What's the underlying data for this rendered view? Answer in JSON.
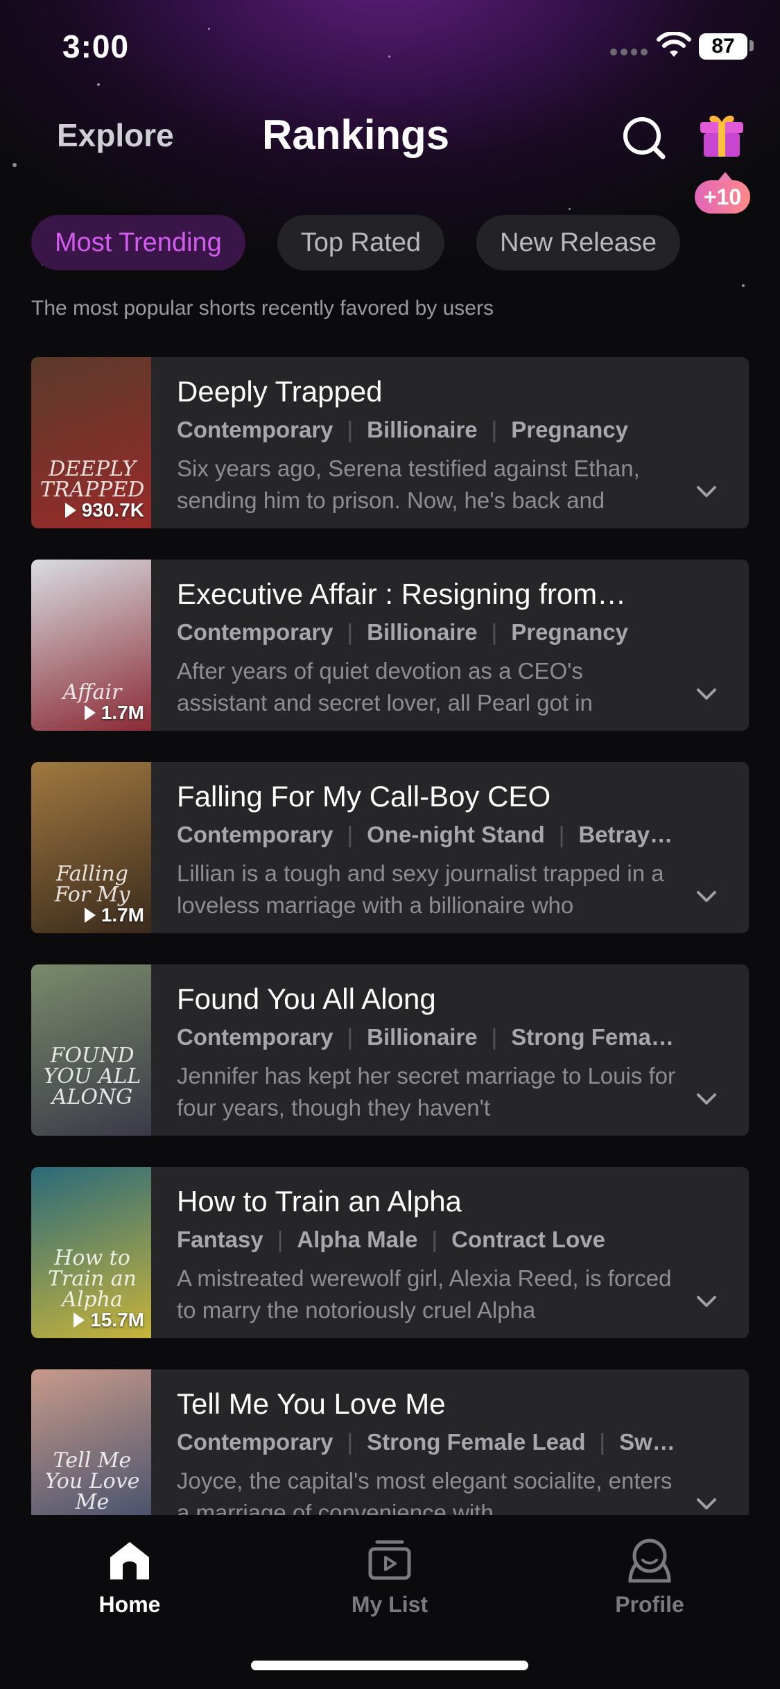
{
  "status": {
    "time": "3:00",
    "battery": "87"
  },
  "header": {
    "explore_label": "Explore",
    "title": "Rankings",
    "gift_badge": "+10"
  },
  "tabs": [
    {
      "label": "Most Trending",
      "active": true
    },
    {
      "label": "Top Rated",
      "active": false
    },
    {
      "label": "New Release",
      "active": false
    }
  ],
  "subtitle": "The most popular shorts recently favored by users",
  "items": [
    {
      "title": "Deeply Trapped",
      "tags": [
        "Contemporary",
        "Billionaire",
        "Pregnancy"
      ],
      "desc": "Six years ago, Serena testified against Ethan, sending him to prison. Now, he's back and",
      "views": "930.7K",
      "cover_text": "DEEPLY TRAPPED",
      "cover_colors": [
        "#5a3a2a",
        "#9a2a2a"
      ]
    },
    {
      "title": "Executive Affair : Resigning from…",
      "tags": [
        "Contemporary",
        "Billionaire",
        "Pregnancy"
      ],
      "desc": "After years of quiet devotion as a CEO's assistant and secret lover, all Pearl got in",
      "views": "1.7M",
      "cover_text": "Affair",
      "cover_colors": [
        "#d8dce2",
        "#8a2a34"
      ]
    },
    {
      "title": "Falling For My Call-Boy CEO",
      "tags": [
        "Contemporary",
        "One-night Stand",
        "Betray…"
      ],
      "desc": "Lillian is a tough and sexy journalist trapped in a loveless marriage with a billionaire who",
      "views": "1.7M",
      "cover_text": "Falling For My",
      "cover_colors": [
        "#a07840",
        "#3a2a1c"
      ]
    },
    {
      "title": "Found You All Along",
      "tags": [
        "Contemporary",
        "Billionaire",
        "Strong Fema…"
      ],
      "desc": "Jennifer has kept her secret marriage to Louis for four years, though they haven't",
      "views": "",
      "cover_text": "FOUND YOU ALL ALONG",
      "cover_colors": [
        "#7a8a6a",
        "#3a3a48"
      ]
    },
    {
      "title": "How to Train an Alpha",
      "tags": [
        "Fantasy",
        "Alpha Male",
        "Contract Love"
      ],
      "desc": "A mistreated werewolf girl, Alexia Reed, is forced to marry the notoriously cruel Alpha",
      "views": "15.7M",
      "cover_text": "How to Train an Alpha",
      "cover_colors": [
        "#2a6a7a",
        "#c8b43a"
      ]
    },
    {
      "title": "Tell Me You Love Me",
      "tags": [
        "Contemporary",
        "Strong Female Lead",
        "Sw…"
      ],
      "desc": "Joyce, the capital's most elegant socialite, enters a marriage of convenience with",
      "views": "",
      "cover_text": "Tell Me You Love Me",
      "cover_colors": [
        "#c89a8a",
        "#3a4a6a"
      ]
    }
  ],
  "bottom_nav": [
    {
      "label": "Home",
      "icon": "home-icon",
      "active": true
    },
    {
      "label": "My List",
      "icon": "play-list-icon",
      "active": false
    },
    {
      "label": "Profile",
      "icon": "profile-icon",
      "active": false
    }
  ],
  "colors": {
    "accent": "#d45cf0",
    "card": "#262629",
    "background": "#0b0b0d"
  }
}
